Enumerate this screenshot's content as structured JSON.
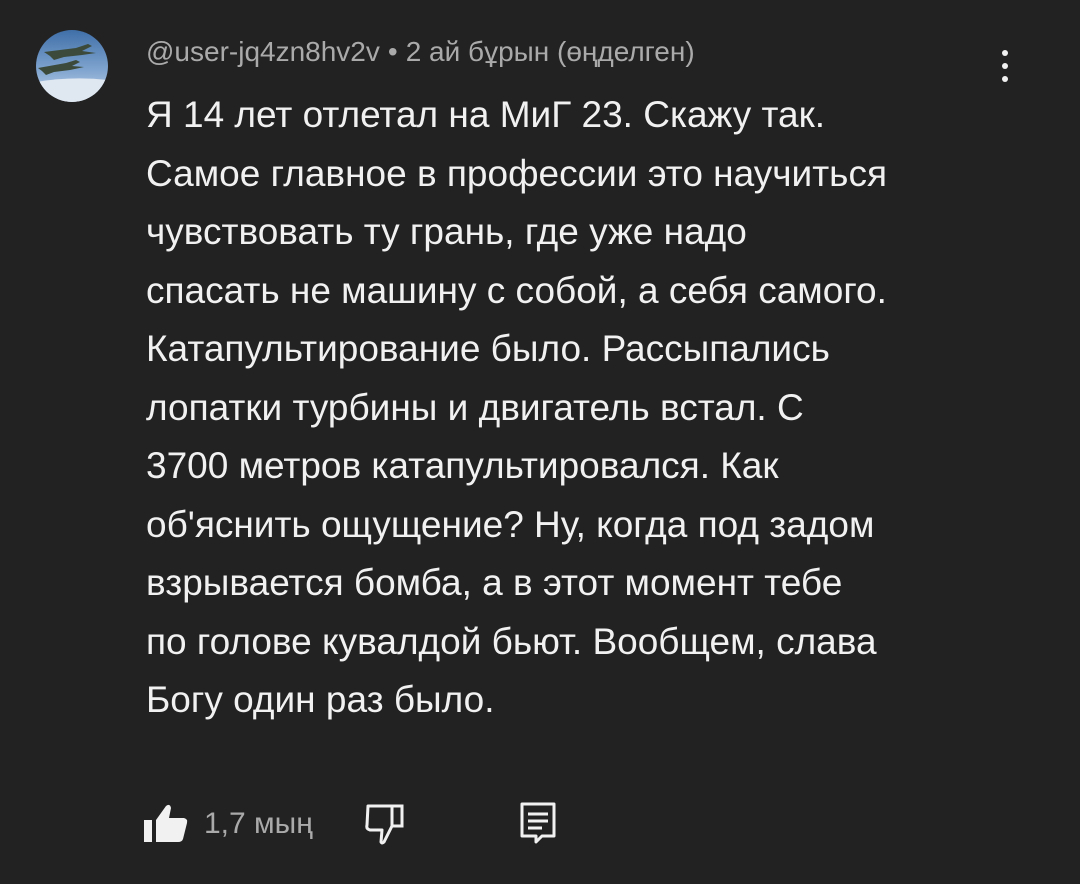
{
  "comment": {
    "author": "@user-jq4zn8hv2v",
    "separator": "•",
    "timestamp": "2 ай бұрын (өңделген)",
    "text": "Я 14 лет отлетал на МиГ 23. Скажу так.\nСамое главное в профессии это научиться\nчувствовать ту грань, где уже надо\nспасать не машину с собой, а себя самого.\nКатапультирование было. Рассыпались\nлопатки турбины и двигатель встал. С\n3700 метров катапультировался. Как\nоб'яснить ощущение? Ну, когда под задом\nвзрывается бомба, а в этот момент тебе\nпо голове кувалдой бьют. Вообщем, слава\nБогу один раз было.",
    "like_count": "1,7 мың"
  },
  "icons": {
    "avatar": "avatar-jets-image",
    "more": "more-vert-icon",
    "like": "thumbs-up-icon",
    "dislike": "thumbs-down-icon",
    "reply": "reply-comment-icon"
  },
  "colors": {
    "background": "#222222",
    "text_primary": "#f1f1f1",
    "text_secondary": "#aaaaaa"
  }
}
